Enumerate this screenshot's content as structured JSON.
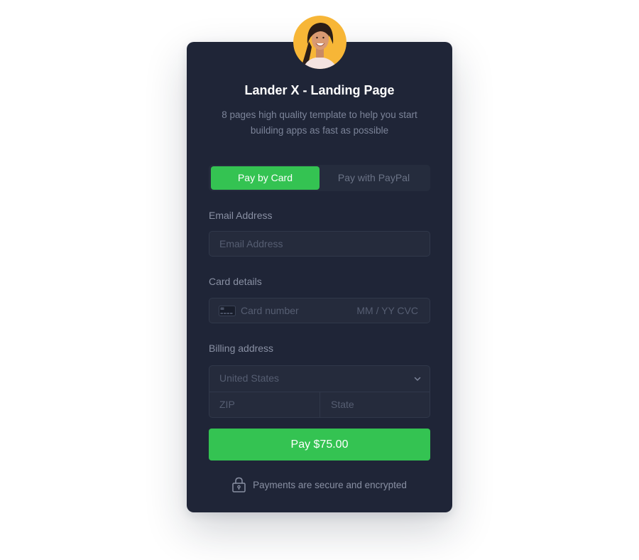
{
  "product": {
    "title": "Lander X - Landing Page",
    "description": "8 pages high quality template to help you start building apps as fast as possible"
  },
  "payment_tabs": [
    {
      "label": "Pay by Card",
      "active": true
    },
    {
      "label": "Pay with PayPal",
      "active": false
    }
  ],
  "email": {
    "label": "Email Address",
    "placeholder": "Email Address"
  },
  "card_details": {
    "label": "Card details",
    "number_placeholder": "Card number",
    "expiry_cvc_placeholder": "MM / YY CVC",
    "icon": "credit-card-icon"
  },
  "billing": {
    "label": "Billing address",
    "country": "United States",
    "zip_placeholder": "ZIP",
    "state_placeholder": "State"
  },
  "pay_button": "Pay $75.00",
  "secure_note": "Payments are secure and encrypted",
  "colors": {
    "accent": "#34c352",
    "card_bg": "#1f2537",
    "field_bg": "#252b3c",
    "avatar_bg": "#f7b637"
  }
}
